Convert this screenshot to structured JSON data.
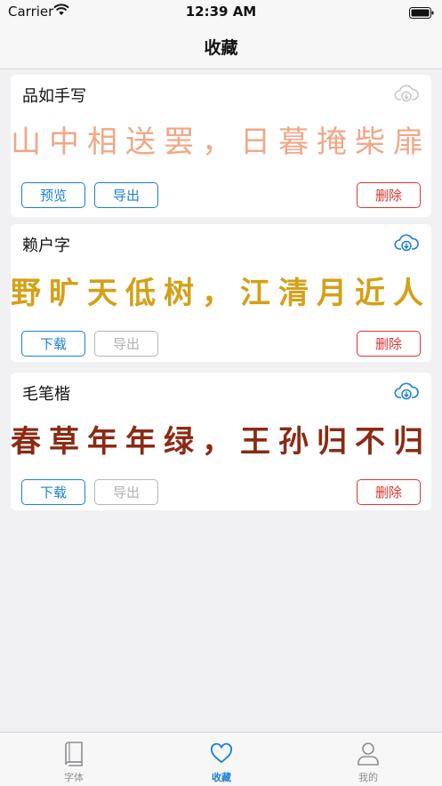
{
  "status_bar": {
    "carrier": "Carrier",
    "time": "12:39 AM"
  },
  "nav": {
    "title": "收藏"
  },
  "colors": {
    "accent": "#1c7fd8",
    "danger": "#e13232",
    "disabled": "#b0b0b0"
  },
  "fonts": [
    {
      "name": "品如手写",
      "preview": "山中相送罢，日暮掩柴扉",
      "preview_color": "#f0a888",
      "cloud_icon": "cloud-download-icon",
      "cloud_state": "downloaded",
      "btn1": "预览",
      "btn2": "导出",
      "btn2_enabled": true,
      "delete": "删除"
    },
    {
      "name": "赖户字",
      "preview": "野旷天低树，江清月近人",
      "preview_color": "#d4a017",
      "cloud_icon": "cloud-download-icon",
      "cloud_state": "available",
      "btn1": "下载",
      "btn2": "导出",
      "btn2_enabled": false,
      "delete": "删除"
    },
    {
      "name": "毛笔楷",
      "preview": "春草年年绿，王孙归不归",
      "preview_color": "#8b2a14",
      "cloud_icon": "cloud-download-icon",
      "cloud_state": "available",
      "btn1": "下载",
      "btn2": "导出",
      "btn2_enabled": false,
      "delete": "删除"
    }
  ],
  "tabs": [
    {
      "label": "字体",
      "icon": "book-icon",
      "active": false
    },
    {
      "label": "收藏",
      "icon": "heart-icon",
      "active": true
    },
    {
      "label": "我的",
      "icon": "person-icon",
      "active": false
    }
  ]
}
